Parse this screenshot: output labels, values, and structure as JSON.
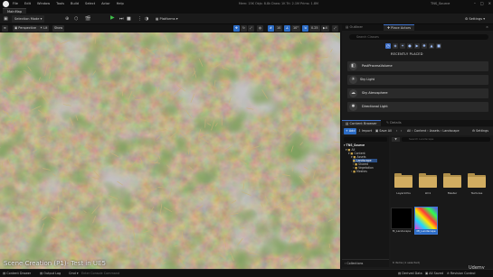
{
  "menubar": {
    "items": [
      "File",
      "Edit",
      "Window",
      "Tools",
      "Build",
      "Select",
      "Actor",
      "Help"
    ],
    "stats": "Mem: 15K  Objs: 8.8k  Draw: 1K  Tri: 2.1M  Prims: 1.8M",
    "project": "TNS_Source"
  },
  "tabs": {
    "map": "MainMap"
  },
  "toolbar": {
    "selection_mode": "Selection Mode",
    "platforms": "Platforms",
    "settings": "Settings"
  },
  "viewport_toolbar": {
    "perspective": "Perspective",
    "lit": "Lit",
    "show": "Show",
    "grid_snap": "10",
    "rotate_snap": "10°",
    "scale_snap": "0.25",
    "camera_speed": "4"
  },
  "viewport": {
    "caption": "Scene Creation (P1)- Test in UE5",
    "watermark": "Udemy"
  },
  "outliner": {
    "tab_label": "Outliner",
    "place_actors_tab": "Place Actors",
    "search_placeholder": "Search Classes",
    "recently_placed_title": "RECENTLY PLACED",
    "recent_items": [
      "PostProcessVolume",
      "Sky Light",
      "Sky Atmosphere",
      "Directional Light"
    ]
  },
  "content_browser": {
    "tab_label": "Content Browser",
    "details_tab": "Details",
    "add": "+ Add",
    "import": "Import",
    "save_all": "Save All",
    "breadcrumb": [
      "All",
      "Content",
      "Assets",
      "Landscape"
    ],
    "settings": "Settings",
    "tree_root": "TNS_Source",
    "tree": [
      {
        "label": "All",
        "depth": 0
      },
      {
        "label": "Content",
        "depth": 1
      },
      {
        "label": "Assets",
        "depth": 2
      },
      {
        "label": "Landscape",
        "depth": 3,
        "selected": true
      },
      {
        "label": "Shared",
        "depth": 3
      },
      {
        "label": "Vegetation",
        "depth": 3
      },
      {
        "label": "Meshes",
        "depth": 2
      }
    ],
    "search_placeholder": "Search Landscape",
    "assets": [
      {
        "name": "Layerinfos",
        "kind": "folder"
      },
      {
        "name": "LIC1",
        "kind": "folder"
      },
      {
        "name": "Master",
        "kind": "folder"
      },
      {
        "name": "Textures",
        "kind": "folder"
      },
      {
        "name": "M_Landscape",
        "kind": "material-black"
      },
      {
        "name": "MI_Landscape",
        "kind": "material-colorful"
      }
    ],
    "collections": "Collections",
    "item_count": "6 items (1 selected)"
  },
  "statusbar": {
    "content_drawer": "Content Drawer",
    "output_log": "Output Log",
    "cmd": "Cmd",
    "console_placeholder": "Enter Console Command",
    "derived_data": "Derived Data",
    "all_saved": "All Saved",
    "revision_control": "Revision Control"
  },
  "colors": {
    "accent": "#2b6bc4",
    "play": "#3fbf4a",
    "folder": "#d2ad61",
    "panel": "#1a1a1a"
  }
}
